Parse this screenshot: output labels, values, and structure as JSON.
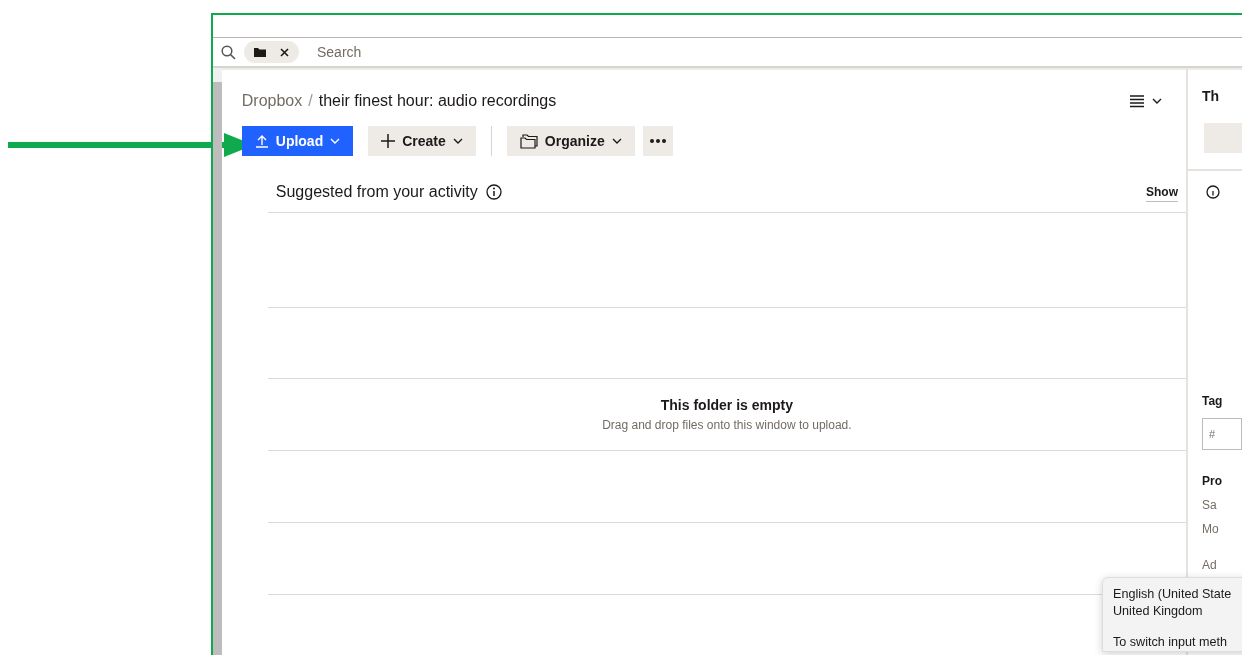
{
  "search": {
    "placeholder": "Search"
  },
  "breadcrumb": {
    "root": "Dropbox",
    "separator": "/",
    "current": "their finest hour: audio recordings"
  },
  "toolbar": [
    {
      "kind": "upload",
      "label": "Upload"
    },
    {
      "kind": "create",
      "label": "Create"
    },
    {
      "kind": "organize",
      "label": "Organize"
    },
    {
      "kind": "more"
    }
  ],
  "suggested": {
    "title": "Suggested from your activity",
    "action": "Show"
  },
  "empty_state": {
    "title": "This folder is empty",
    "hint": "Drag and drop files onto this window to upload."
  },
  "details_panel": {
    "title": "Th",
    "tags_label": "Tag",
    "tags_placeholder": "#",
    "section_title": "Pro",
    "lines": [
      "Sa",
      "Mo",
      "Ad"
    ]
  },
  "tooltip": {
    "lines": [
      "English (United State",
      "United Kingdom",
      "To switch input meth"
    ]
  }
}
